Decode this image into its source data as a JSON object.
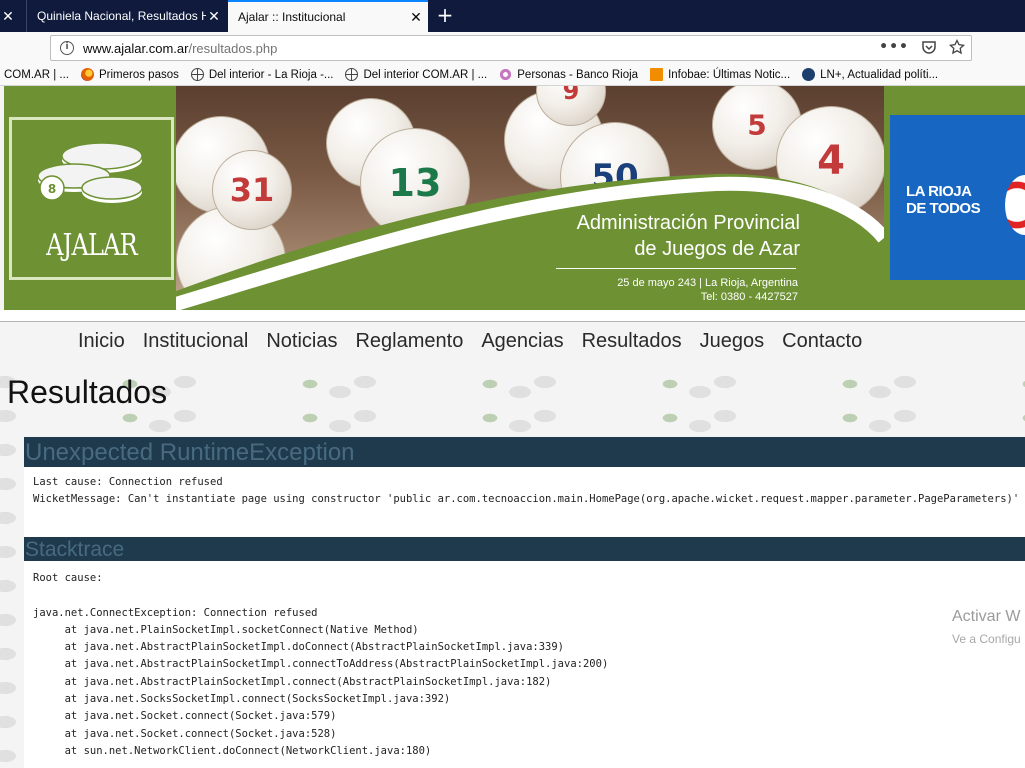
{
  "browser": {
    "tabs": [
      {
        "title": "",
        "active": false
      },
      {
        "title": "Quiniela Nacional, Resultados Hoy",
        "active": false
      },
      {
        "title": "Ajalar :: Institucional",
        "active": true
      }
    ],
    "close_glyph": "✕",
    "new_tab_glyph": "+",
    "url": {
      "domain": "www.ajalar.com.ar",
      "path": "/resultados.php"
    },
    "bookmarks": [
      {
        "label": "COM.AR | ...",
        "icon": "none"
      },
      {
        "label": "Primeros pasos",
        "icon": "firefox-icon",
        "color": "#e66000"
      },
      {
        "label": "Del interior - La Rioja -...",
        "icon": "globe-icon",
        "color": "#444444"
      },
      {
        "label": "Del interior COM.AR | ...",
        "icon": "globe-icon",
        "color": "#444444"
      },
      {
        "label": "Personas - Banco Rioja",
        "icon": "flower-icon",
        "color": "#c678c0"
      },
      {
        "label": "Infobae: Últimas Notic...",
        "icon": "infobae-icon",
        "color": "#f28c00"
      },
      {
        "label": "LN+, Actualidad políti...",
        "icon": "ln-icon",
        "color": "#1d3f6e"
      }
    ]
  },
  "banner": {
    "logo_text": "AJALAR",
    "title_line1": "Administración Provincial",
    "title_line2": "de Juegos de Azar",
    "address": "25 de mayo 243 | La Rioja, Argentina",
    "phone": "Tel: 0380 - 4427527",
    "rioja_line1": "LA RIOJA",
    "rioja_line2": "DE TODOS",
    "balls": [
      "31",
      "13",
      "50",
      "4",
      "9",
      "5"
    ]
  },
  "menu": [
    "Inicio",
    "Institucional",
    "Noticias",
    "Reglamento",
    "Agencias",
    "Resultados",
    "Juegos",
    "Contacto"
  ],
  "page_title": "Resultados",
  "error": {
    "heading": "Unexpected RuntimeException",
    "last_cause": "Last cause: Connection refused",
    "wicket_message": "WicketMessage: Can't instantiate page using constructor 'public ar.com.tecnoaccion.main.HomePage(org.apache.wicket.request.mapper.parameter.PageParameters)' an"
  },
  "stacktrace": {
    "heading": "Stacktrace",
    "lines": [
      "Root cause:",
      "",
      "java.net.ConnectException: Connection refused",
      "     at java.net.PlainSocketImpl.socketConnect(Native Method)",
      "     at java.net.AbstractPlainSocketImpl.doConnect(AbstractPlainSocketImpl.java:339)",
      "     at java.net.AbstractPlainSocketImpl.connectToAddress(AbstractPlainSocketImpl.java:200)",
      "     at java.net.AbstractPlainSocketImpl.connect(AbstractPlainSocketImpl.java:182)",
      "     at java.net.SocksSocketImpl.connect(SocksSocketImpl.java:392)",
      "     at java.net.Socket.connect(Socket.java:579)",
      "     at java.net.Socket.connect(Socket.java:528)",
      "     at sun.net.NetworkClient.doConnect(NetworkClient.java:180)"
    ]
  },
  "watermark": {
    "line1": "Activar W",
    "line2": "Ve a Configu"
  }
}
